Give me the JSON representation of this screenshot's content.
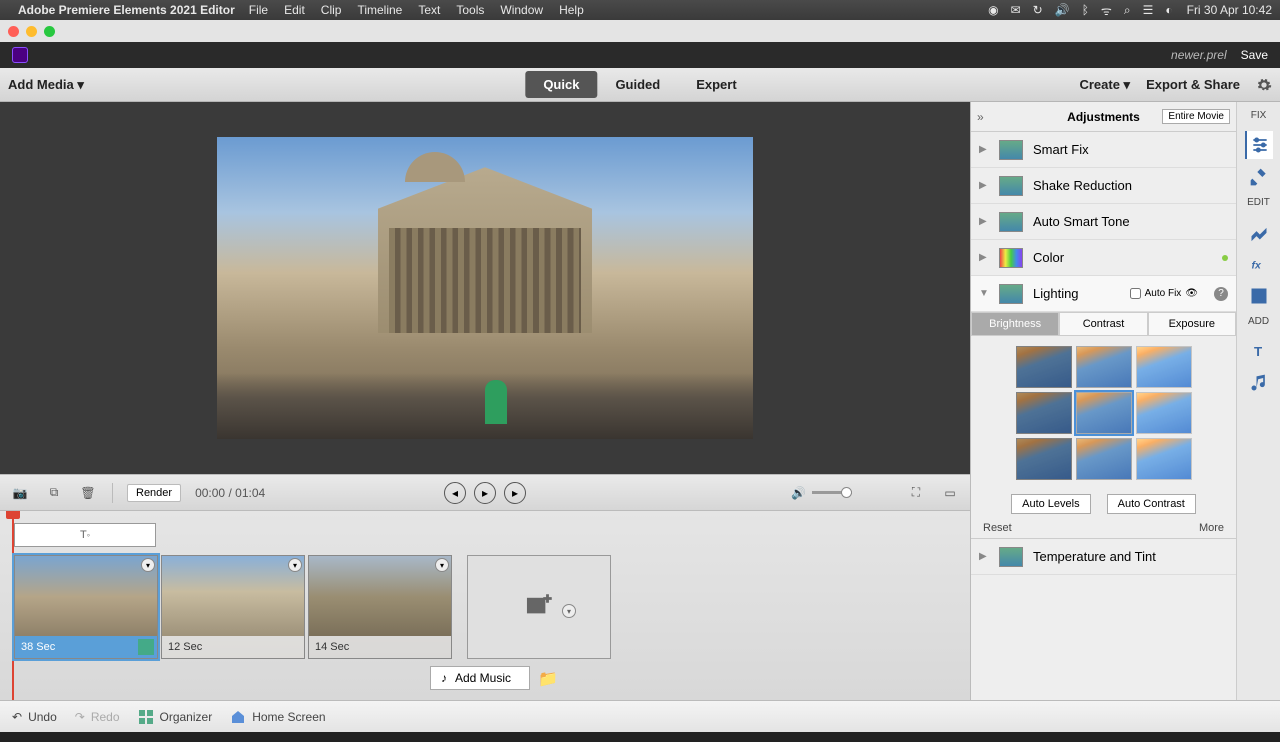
{
  "mac": {
    "app_name": "Adobe Premiere Elements 2021 Editor",
    "menus": [
      "File",
      "Edit",
      "Clip",
      "Timeline",
      "Text",
      "Tools",
      "Window",
      "Help"
    ],
    "datetime": "Fri 30 Apr  10:42"
  },
  "header": {
    "filename": "newer.prel",
    "save": "Save"
  },
  "toolbar": {
    "add_media": "Add Media",
    "tabs": {
      "quick": "Quick",
      "guided": "Guided",
      "expert": "Expert"
    },
    "create": "Create",
    "export": "Export & Share"
  },
  "playback": {
    "render": "Render",
    "time_current": "00:00",
    "time_sep": "/",
    "time_total": "01:04"
  },
  "timeline": {
    "title_placeholder": "T",
    "clips": [
      {
        "duration": "38 Sec"
      },
      {
        "duration": "12 Sec"
      },
      {
        "duration": "14 Sec"
      }
    ],
    "add_music": "Add Music"
  },
  "adjustments": {
    "title": "Adjustments",
    "entire": "Entire Movie",
    "items": {
      "smartfix": "Smart Fix",
      "shake": "Shake Reduction",
      "autotone": "Auto Smart Tone",
      "color": "Color",
      "lighting": "Lighting",
      "temp": "Temperature and Tint"
    },
    "autofix_label": "Auto Fix",
    "subtabs": {
      "brightness": "Brightness",
      "contrast": "Contrast",
      "exposure": "Exposure"
    },
    "auto_levels": "Auto Levels",
    "auto_contrast": "Auto Contrast",
    "reset": "Reset",
    "more": "More"
  },
  "sidestrip": {
    "fix": "FIX",
    "edit": "EDIT",
    "add": "ADD"
  },
  "bottom": {
    "undo": "Undo",
    "redo": "Redo",
    "organizer": "Organizer",
    "home": "Home Screen"
  }
}
